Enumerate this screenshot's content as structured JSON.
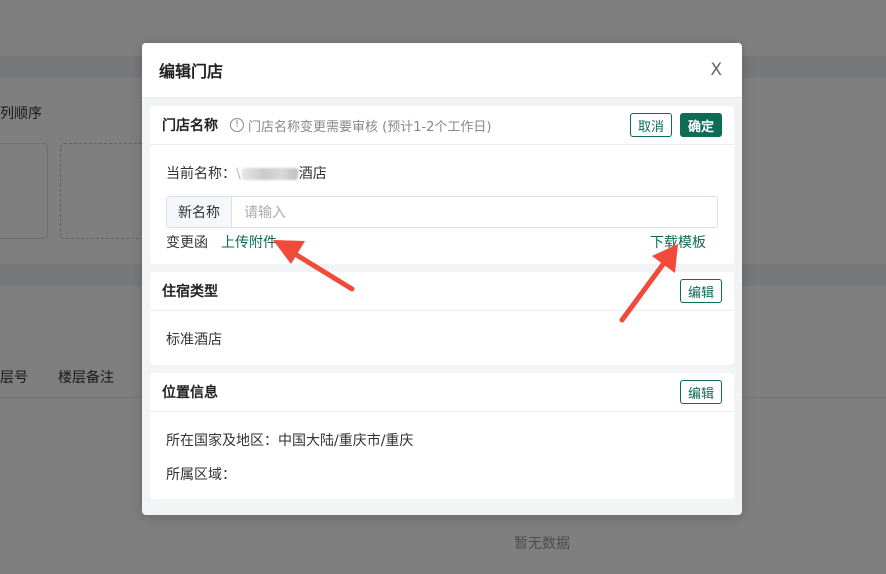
{
  "background": {
    "col_order_label": "列顺序",
    "floor_no_label": "层号",
    "floor_remark_label": "楼层备注",
    "empty_text": "暂无数据"
  },
  "dialog": {
    "title": "编辑门店",
    "close_label": "X"
  },
  "store_name": {
    "title": "门店名称",
    "hint": "门店名称变更需要审核 (预计1-2个工作日)",
    "cancel_label": "取消",
    "confirm_label": "确定",
    "current_label": "当前名称：",
    "current_prefix": "\\",
    "current_suffix": "酒店",
    "new_name_label": "新名称",
    "new_name_placeholder": "请输入",
    "change_letter_label": "变更函",
    "upload_label": "上传附件",
    "download_label": "下载模板"
  },
  "lodging": {
    "title": "住宿类型",
    "edit_label": "编辑",
    "value": "标准酒店"
  },
  "location": {
    "title": "位置信息",
    "edit_label": "编辑",
    "country_label": "所在国家及地区：",
    "country_value": "中国大陆/重庆市/重庆",
    "district_label": "所属区域："
  },
  "colors": {
    "accent": "#0e6b56",
    "arrow": "#f04a3a"
  }
}
